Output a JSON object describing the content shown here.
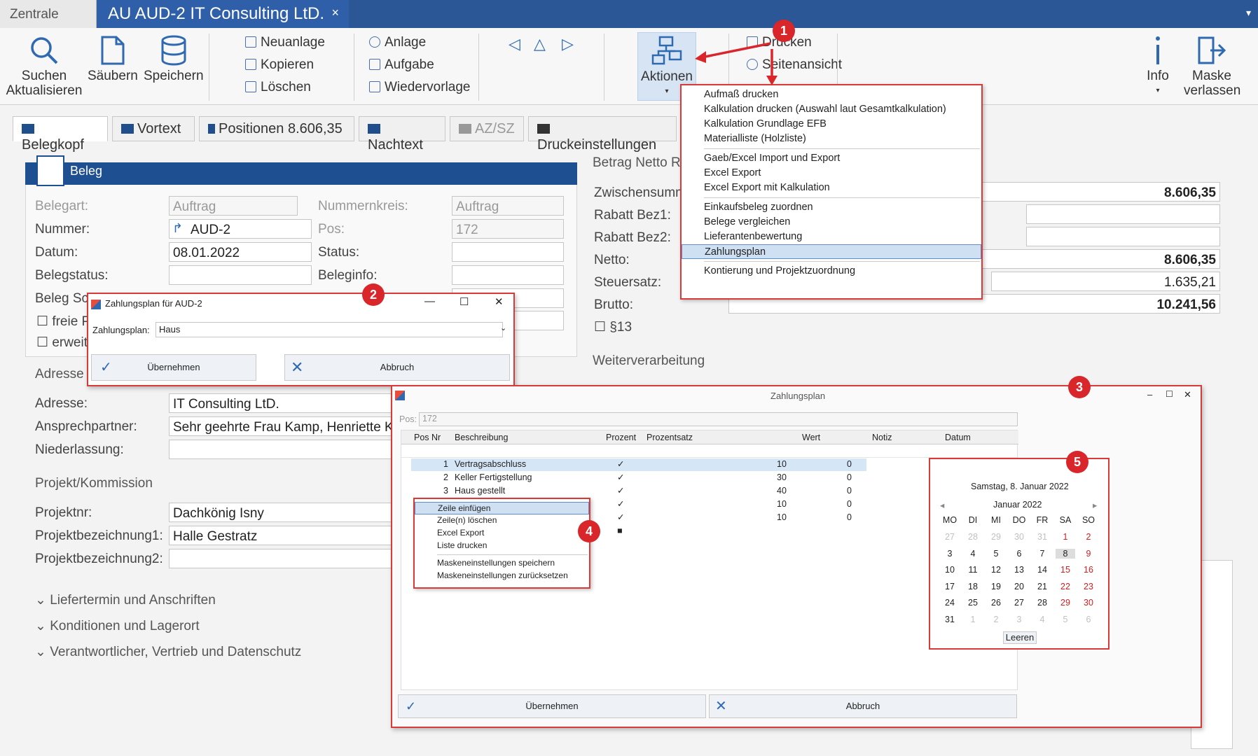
{
  "tabs": {
    "zentrale": "Zentrale",
    "active": "AU AUD-2 IT Consulting LtD.",
    "close": "×",
    "overflow": "▾"
  },
  "ribbon": {
    "suchen": "Suchen",
    "aktualisieren": "Aktualisieren",
    "saeubern": "Säubern",
    "speichern": "Speichern",
    "neuanlage": "Neuanlage",
    "kopieren": "Kopieren",
    "loeschen": "Löschen",
    "anlage": "Anlage",
    "aufgabe": "Aufgabe",
    "wiedervorlage": "Wiedervorlage",
    "aktionen": "Aktionen",
    "drucken": "Drucken",
    "seitenansicht": "Seitenansicht",
    "info": "Info",
    "maske": "Maske",
    "verlassen": "verlassen"
  },
  "form_tabs": [
    "Belegkopf",
    "Vortext",
    "Positionen 8.606,35",
    "Nachtext",
    "AZ/SZ",
    "Druckeinstellungen"
  ],
  "beleg": {
    "title": "Beleg",
    "belegart_label": "Belegart:",
    "belegart": "Auftrag",
    "nummernkreis_label": "Nummernkreis:",
    "nummernkreis": "Auftrag",
    "nummer_label": "Nummer:",
    "nummer": "AUD-2",
    "pos_label": "Pos:",
    "pos": "172",
    "datum_label": "Datum:",
    "datum": "08.01.2022",
    "status_label": "Status:",
    "belegstatus_label": "Belegstatus:",
    "beleginfo_label": "Beleginfo:",
    "belegsch_label": "Beleg Sch",
    "freie_label": "freie P",
    "erweit_label": "erweit"
  },
  "adresse": {
    "group": "Adresse",
    "adresse_label": "Adresse:",
    "adresse": "IT Consulting LtD.",
    "ansprech_label": "Ansprechpartner:",
    "ansprech": "Sehr geehrte Frau Kamp, Henriette Kamp",
    "nieder_label": "Niederlassung:"
  },
  "projekt": {
    "group": "Projekt/Kommission",
    "nr_label": "Projektnr:",
    "nr": "Dachkönig Isny",
    "bez1_label": "Projektbezeichnung1:",
    "bez1": "Halle Gestratz",
    "bez2_label": "Projektbezeichnung2:"
  },
  "collapsed": [
    "Liefertermin und Anschriften",
    "Konditionen und Lagerort",
    "Verantwortlicher, Vertrieb und Datenschutz"
  ],
  "betrag": {
    "group": "Betrag Netto Ra",
    "zwischen_label": "Zwischensumme",
    "zwischen": "8.606,35",
    "rabatt1_label": "Rabatt Bez1:",
    "rabatt2_label": "Rabatt Bez2:",
    "netto_label": "Netto:",
    "netto": "8.606,35",
    "steuer_label": "Steuersatz:",
    "steuer": "1.635,21",
    "brutto_label": "Brutto:",
    "brutto": "10.241,56",
    "p13": "§13"
  },
  "weiter": "Weiterverarbeitung",
  "aktionen_menu": [
    [
      "Aufmaß drucken",
      "Kalkulation drucken (Auswahl laut Gesamtkalkulation)",
      "Kalkulation Grundlage EFB",
      "Materialliste (Holzliste)"
    ],
    [
      "Gaeb/Excel Import und Export",
      "Excel Export",
      "Excel Export mit Kalkulation"
    ],
    [
      "Einkaufsbeleg zuordnen",
      "Belege vergleichen",
      "Lieferantenbewertung",
      "Zahlungsplan"
    ],
    [
      "Kontierung und Projektzuordnung"
    ]
  ],
  "badges": [
    "1",
    "2",
    "3",
    "4",
    "5"
  ],
  "dlg_small": {
    "title": "Zahlungsplan für AUD-2",
    "label": "Zahlungsplan:",
    "value": "Haus",
    "ok": "Übernehmen",
    "cancel": "Abbruch",
    "minimize": "—",
    "maximize": "☐",
    "close": "✕"
  },
  "dlg_big": {
    "title": "Zahlungsplan",
    "pos_label": "Pos:",
    "pos": "172",
    "columns": [
      "Pos Nr",
      "Beschreibung",
      "Prozent",
      "Prozentsatz",
      "Wert",
      "Notiz",
      "Datum"
    ],
    "rows": [
      {
        "nr": "1",
        "besch": "Vertragsabschluss",
        "satz": "10",
        "wert": "0"
      },
      {
        "nr": "2",
        "besch": "Keller Fertigstellung",
        "satz": "30",
        "wert": "0"
      },
      {
        "nr": "3",
        "besch": "Haus gestellt",
        "satz": "40",
        "wert": "0"
      },
      {
        "nr": "",
        "besch": "",
        "satz": "10",
        "wert": "0"
      },
      {
        "nr": "",
        "besch": "",
        "satz": "10",
        "wert": "0"
      }
    ],
    "ok": "Übernehmen",
    "cancel": "Abbruch",
    "controls": [
      "–",
      "☐",
      "✕"
    ]
  },
  "context_menu": [
    "Zeile einfügen",
    "Zeile(n) löschen",
    "Excel Export",
    "Liste drucken",
    "Maskeneinstellungen speichern",
    "Maskeneinstellungen zurücksetzen"
  ],
  "calendar": {
    "today": "Samstag, 8. Januar 2022",
    "month": "Januar 2022",
    "weekdays": [
      "MO",
      "DI",
      "MI",
      "DO",
      "FR",
      "SA",
      "SO"
    ],
    "weeks": [
      [
        "27",
        "28",
        "29",
        "30",
        "31",
        "1",
        "2"
      ],
      [
        "3",
        "4",
        "5",
        "6",
        "7",
        "8",
        "9"
      ],
      [
        "10",
        "11",
        "12",
        "13",
        "14",
        "15",
        "16"
      ],
      [
        "17",
        "18",
        "19",
        "20",
        "21",
        "22",
        "23"
      ],
      [
        "24",
        "25",
        "26",
        "27",
        "28",
        "29",
        "30"
      ],
      [
        "31",
        "1",
        "2",
        "3",
        "4",
        "5",
        "6"
      ]
    ],
    "clear": "Leeren"
  }
}
